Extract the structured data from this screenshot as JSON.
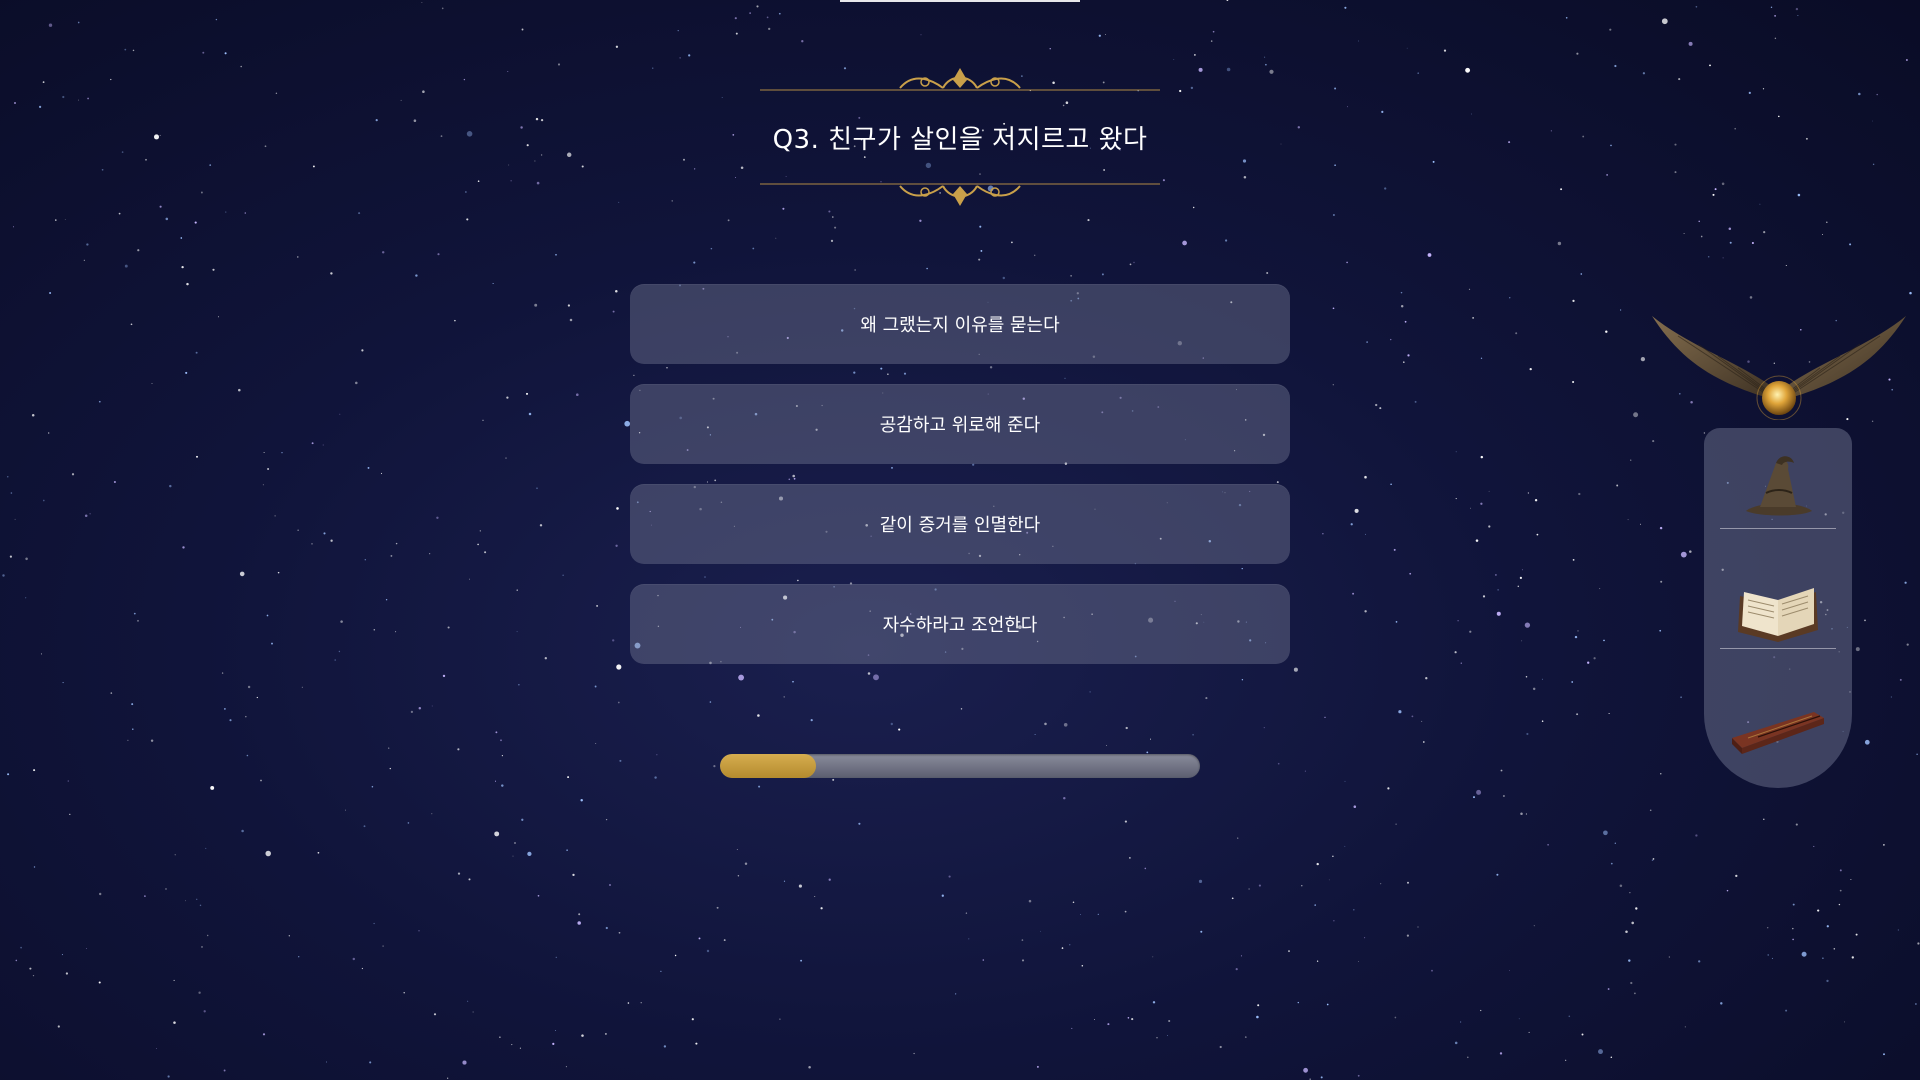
{
  "quiz": {
    "question": "Q3. 친구가 살인을 저지르고 왔다",
    "answers": [
      "왜 그랬는지 이유를 묻는다",
      "공감하고 위로해 준다",
      "같이 증거를 인멸한다",
      "자수하라고 조언한다"
    ]
  },
  "progress": {
    "fraction": 0.2
  },
  "sidebar": {
    "items": [
      {
        "icon": "sorting-hat-icon"
      },
      {
        "icon": "spell-book-icon"
      },
      {
        "icon": "magic-wand-icon"
      }
    ]
  },
  "decorations": {
    "top_icon": "golden-snitch-icon"
  },
  "colors": {
    "background": "#10143a",
    "accent_gold": "#c9a04a",
    "answer_bg": "#5a5d78"
  }
}
